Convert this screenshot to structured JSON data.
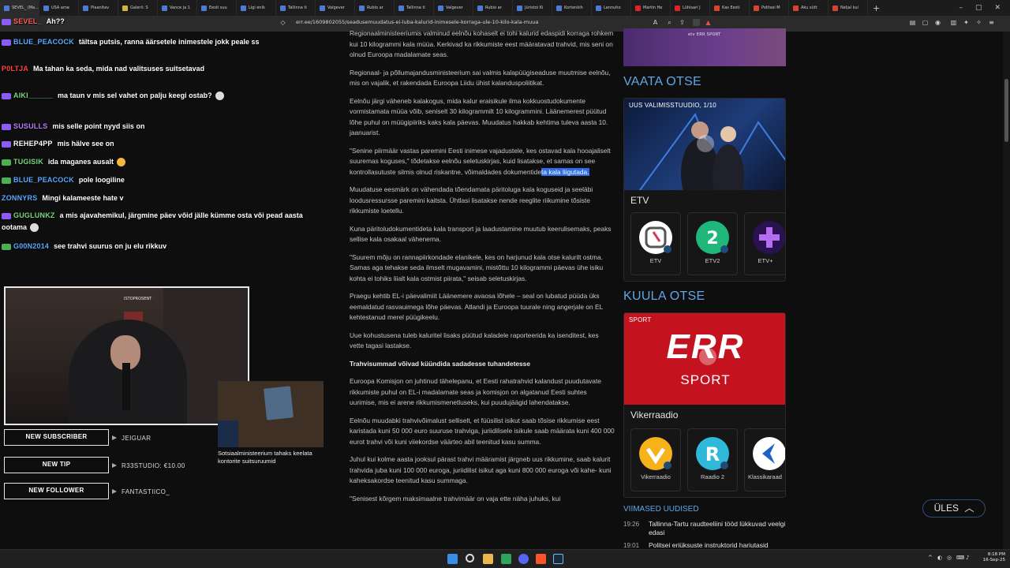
{
  "browser": {
    "tabs": [
      {
        "label": "SEVEL_ (Ma...",
        "icon": "twitch",
        "active": true
      },
      {
        "label": "USA ame",
        "icon": "globe"
      },
      {
        "label": "Plaanitav",
        "icon": "globe"
      },
      {
        "label": "Galerii: S",
        "icon": "gallery"
      },
      {
        "label": "Vance ja 1",
        "icon": "globe"
      },
      {
        "label": "Eesti suu",
        "icon": "globe"
      },
      {
        "label": "Ligi enik",
        "icon": "globe"
      },
      {
        "label": "Tallinna ti",
        "icon": "globe"
      },
      {
        "label": "Valgever",
        "icon": "globe"
      },
      {
        "label": "Rubio ar",
        "icon": "globe"
      },
      {
        "label": "Tallinna ti",
        "icon": "globe"
      },
      {
        "label": "Valgever",
        "icon": "globe"
      },
      {
        "label": "Rubio ar",
        "icon": "globe"
      },
      {
        "label": "Jüristoi Ki",
        "icon": "globe"
      },
      {
        "label": "Kortenkih",
        "icon": "globe"
      },
      {
        "label": "Lennuho",
        "icon": "globe"
      },
      {
        "label": "Martin He",
        "icon": "youtube"
      },
      {
        "label": "Lühisari J",
        "icon": "youtube"
      },
      {
        "label": "Kas Eesti",
        "icon": "err"
      },
      {
        "label": "Politsei M",
        "icon": "err"
      },
      {
        "label": "Aku sütt",
        "icon": "err"
      },
      {
        "label": "Neljal kui",
        "icon": "err"
      }
    ],
    "url": "err.ee/1609802055/seadusemuudatus-ei-luba-kalurid-inimesele-korraga-ule-10-kilo-kala-muua"
  },
  "chat": [
    {
      "user": "SEVEL_",
      "msg": "Ah??",
      "color": "#ff5c5c",
      "emote": false,
      "badge": "purple"
    },
    {
      "user": "BLUE_PEACOCK",
      "msg": "tältsa putsis, ranna äärsetele inimestele jokk peale ss",
      "color": "#5aa9ff",
      "emote": false,
      "badge": "purple"
    },
    {
      "user": "P0LTJA",
      "msg": "Ma tahan ka seda, mida nad valitsuses suitsetavad",
      "color": "#ff4444",
      "emote": false,
      "badge": "none"
    },
    {
      "user": "AIKI______",
      "msg": "ma taun v mis sel vahet on palju keegi ostab?",
      "color": "#7cd67c",
      "emote": true,
      "badge": "purple"
    },
    {
      "user": "SUSULLS",
      "msg": "mis selle point nyyd siis on",
      "color": "#b47cff",
      "emote": false,
      "badge": "purple"
    },
    {
      "user": "REHEP4PP",
      "msg": "mis hälve see on",
      "color": "#ffffff",
      "emote": false,
      "badge": "purple"
    },
    {
      "user": "TUGISIK",
      "msg": "ida maganes ausalt",
      "color": "#7cd67c",
      "emote": true,
      "badge": "green"
    },
    {
      "user": "BLUE_PEACOCK",
      "msg": "pole loogiline",
      "color": "#5aa9ff",
      "emote": false,
      "badge": "green"
    },
    {
      "user": "ZONNYRS",
      "msg": "Mingi kalameeste hate v",
      "color": "#5aa9ff",
      "emote": false,
      "badge": "none"
    },
    {
      "user": "GUGLUNKZ",
      "msg": "a mis ajavahemikul, järgmine päev võid jälle kümme osta või pead aasta ootama",
      "color": "#7cd67c",
      "emote": true,
      "badge": "purple"
    },
    {
      "user": "G00N2014",
      "msg": "see trahvi suurus on ju elu rikkuv",
      "color": "#5aa9ff",
      "emote": false,
      "badge": "green"
    }
  ],
  "stream": {
    "cam_sign": "ISTOPROSENT",
    "tv_caption": "Sotsiaalministeerium tahaks keelata kontorite suitsuruumid",
    "alerts": [
      {
        "label": "NEW SUBSCRIBER",
        "value": "JEIGUAR"
      },
      {
        "label": "NEW TIP",
        "value": "R33STUDIO: €10.00"
      },
      {
        "label": "NEW FOLLOWER",
        "value": "FANTASTIICO_"
      }
    ]
  },
  "article": {
    "p1": "Regionaalministeeriumis valminud eelnõu kohaselt ei tohi kalurid edaspidi korraga rohkem kui 10 kilogrammi kala müüa. Kerkivad ka rikkumiste eest määratavad trahvid, mis seni on olnud Euroopa madalamate seas.",
    "p2": "Regionaal- ja põllumajandusministeerium sai valmis kalapüügiseaduse muutmise eelnõu, mis on vajalik, et rakendada Euroopa Liidu ühist kalanduspoliitikat.",
    "p3": "Eelnõu järgi väheneb kalakogus, mida kalur eraisikule ilma kokkuostudokumente vormistamata müüa võib, seniselt 30 kilogrammilt 10 kilogrammini. Läänemerest püütud lõhe puhul on müügipiiriks kaks kala päevas. Muudatus hakkab kehtima tuleva aasta 10. jaanuarist.",
    "p4_a": "\"Senine piirmäär vastas paremini Eesti inimese vajadustele, kes ostavad kala hooajaliselt suuremas koguses,\" tõdetakse eelnõu seletuskirjas, kuid lisatakse, et samas on see kontrollasutuste silmis olnud riskantne, võimaldades dokumentide",
    "p4_hl": "ta kala liigutada.",
    "p5": "Muudatuse eesmärk on vähendada tõendamata päritoluga kala koguseid ja seeläbi loodusressursse paremini kaitsta. Ühtlasi lisatakse nende reeglite riikumine tõsiste rikkumiste loetellu.",
    "p6": "Kuna päritoludokumentideta kala transport ja laadustamine muutub keerulisemaks, peaks sellise kala osakaal vähenema.",
    "p7": "\"Suurem mõju on rannapiirkondade elanikele, kes on harjunud kala otse kalurilt ostma. Samas aga tehakse seda ilmselt mugavamini, mistõttu 10 kilogrammi päevas ühe isiku kohta ei tohiks liialt kala ostmist piirata,\" seisab seletuskirjas.",
    "p8": "Praegu kehtib EL-i päevalimiit Läänemere avaosa lõhele – seal on lubatud püüda üks eemaldatud rasvauimega lõhe päevas. Atlandi ja Euroopa tuurale ning angerjale on EL kehtestanud merel püügikeelu.",
    "p9": "Uue kohustusena tuleb kaluritel lisaks püütud kaladele raporteerida ka isenditest, kes vette tagasi lastakse.",
    "sub": "Trahvisummad võivad küündida sadadesse tuhandetesse",
    "p10": "Euroopa Komisjon on juhtinud tähelepanu, et Eesti rahatrahvid kalandust puudutavate rikkumiste puhul on EL-i madalamate seas ja komisjon on algatanud Eesti suhtes uurimise, mis ei arene rikkumismenetluseks, kui puudujäägid lahendatakse.",
    "p11": "Eelnõu muudabki trahvivõimalust selliselt, et füüsilist isikut saab tõsise rikkumise eest karistada kuni 50 000 euro suuruse trahviga, juriidilisele isikule saab määrata kuni 400 000 eurot trahvi või kuni viiekordse väärteo abil teenitud kasu summa.",
    "p12": "Juhul kui kolme aasta jooksul pärast trahvi määramist järgneb uus rikkumine, saab kalurit trahvida juba kuni 100 000 euroga, juriidilist isikut aga kuni 800 000 euroga või kahe- kuni kaheksakordse teenitud kasu summaga.",
    "p13": "\"Senisest kõrgem maksimaalne trahvimäär on vaja ette näha juhuks, kui"
  },
  "sidebar": {
    "banner_logo": "etv ERR SPORT",
    "vaata_title": "VAATA OTSE",
    "tv_card": {
      "label": "UUS VALIMISSTUUDIO, 1/10",
      "channel": "ETV"
    },
    "tv_channels": [
      {
        "label": "ETV",
        "color": "#d7d7d7"
      },
      {
        "label": "ETV2",
        "color": "#1fb87a"
      },
      {
        "label": "ETV+",
        "color": "#7a2fd1"
      }
    ],
    "kuula_title": "KUULA OTSE",
    "radio_card": {
      "label": "SPORT",
      "logo": "ERR",
      "logo_sub": "SPORT",
      "channel": "Vikerraadio"
    },
    "radio_channels": [
      {
        "label": "Vikerraadio",
        "color": "#f6b21a"
      },
      {
        "label": "Raadio 2",
        "color": "#2fb8d8"
      },
      {
        "label": "Klassikaraad",
        "color": "#1b63c9"
      }
    ],
    "latest_title": "VIIMASED UUDISED",
    "latest": [
      {
        "time": "19:26",
        "text": "Tallinna-Tartu raudteeliini tööd lükkuvad veelgi edasi"
      },
      {
        "time": "19:01",
        "text": "Politsei eriüksuste instruktorid hariutasid"
      }
    ],
    "back_to_top": "ÜLES"
  },
  "taskbar": {
    "time": "8:18 PM",
    "date": "16-Sep-25"
  }
}
